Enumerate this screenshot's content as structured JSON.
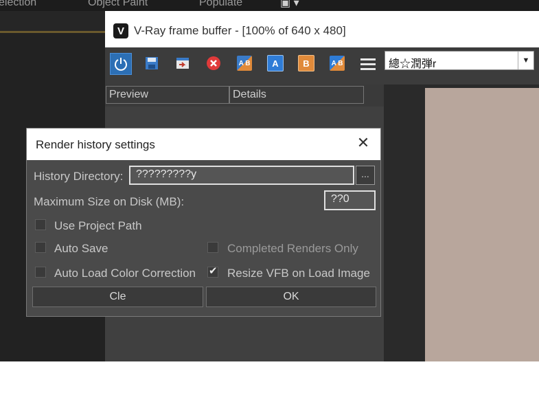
{
  "max_menu": {
    "items": [
      "election",
      "Object Paint",
      "Populate"
    ]
  },
  "vfb": {
    "logo": "V",
    "title": "V-Ray frame buffer - [100% of 640 x 480]",
    "toolbar": {
      "channel_select_value": "總☆潤弾r",
      "channel_arrow": "▼",
      "icon_a": "A",
      "icon_b": "B"
    },
    "tabs": [
      "Preview",
      "Details"
    ]
  },
  "dialog": {
    "title": "Render history settings",
    "close_glyph": "✕",
    "history_directory_label": "History Directory:",
    "history_directory_value": "?????????y",
    "browse_label": "...",
    "max_size_label": "Maximum Size on Disk (MB):",
    "max_size_value": "??0",
    "checkboxes": {
      "use_project_path": {
        "label": "Use Project Path",
        "checked": false
      },
      "auto_save": {
        "label": "Auto Save",
        "checked": false
      },
      "completed_renders_only": {
        "label": "Completed Renders Only",
        "checked": false
      },
      "auto_load_color_correction": {
        "label": "Auto Load Color Correction",
        "checked": false
      },
      "resize_vfb_on_load_image": {
        "label": "Resize VFB on Load Image",
        "checked": true
      }
    },
    "buttons": {
      "clear": "Cle",
      "ok": "OK"
    }
  },
  "colors": {
    "accent_blue": "#2c6fb5",
    "image_tint": "#b8a69c",
    "dialog_bg": "#4a4a4a"
  }
}
